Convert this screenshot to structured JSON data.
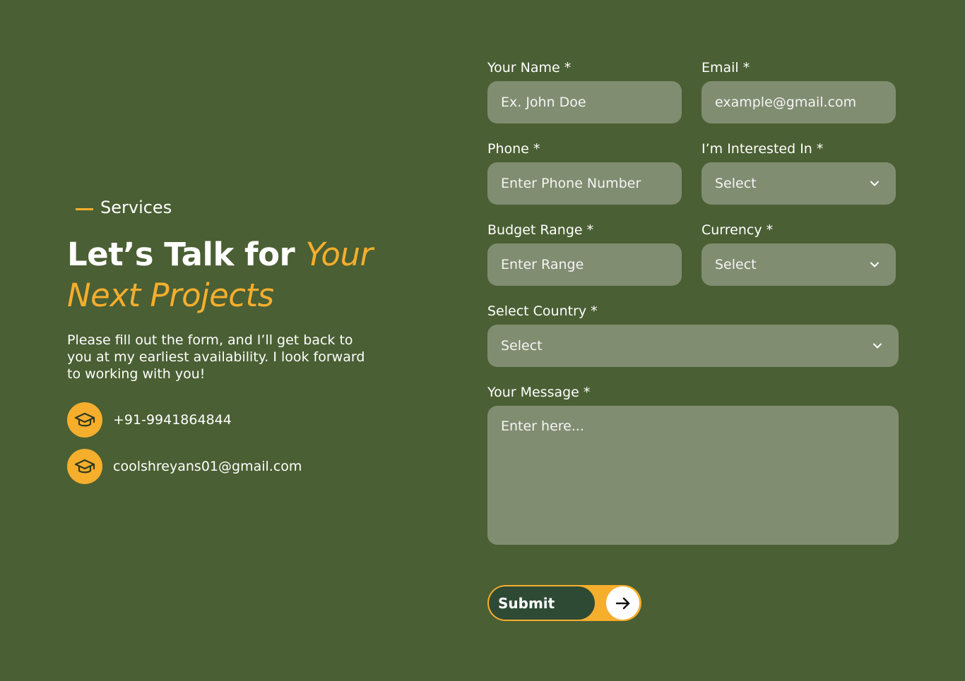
{
  "intro": {
    "eyebrow": "Services",
    "headline_white": "Let’s Talk for ",
    "headline_accent_1": "Your",
    "headline_accent_2": "Next Projects",
    "description": "Please fill out the form, and I’ll get back to you at my earliest availability. I look forward to working with you!",
    "contacts": [
      {
        "icon": "graduation-cap-icon",
        "text": "+91-9941864844"
      },
      {
        "icon": "graduation-cap-icon",
        "text": "coolshreyans01@gmail.com"
      }
    ]
  },
  "form": {
    "name": {
      "label": "Your Name *",
      "placeholder": "Ex. John Doe"
    },
    "email": {
      "label": "Email *",
      "placeholder": "example@gmail.com"
    },
    "phone": {
      "label": "Phone *",
      "placeholder": "Enter Phone Number"
    },
    "interest": {
      "label": "I’m Interested In *",
      "value": "Select"
    },
    "budget": {
      "label": "Budget Range *",
      "placeholder": "Enter Range"
    },
    "currency": {
      "label": "Currency *",
      "value": "Select"
    },
    "country": {
      "label": "Select Country *",
      "value": "Select"
    },
    "message": {
      "label": "Your Message *",
      "placeholder": "Enter here..."
    },
    "submit_label": "Submit"
  },
  "colors": {
    "background": "#4a5f33",
    "accent": "#f6ae2d",
    "field": "#818d71",
    "button_dark": "#2e4a35"
  }
}
